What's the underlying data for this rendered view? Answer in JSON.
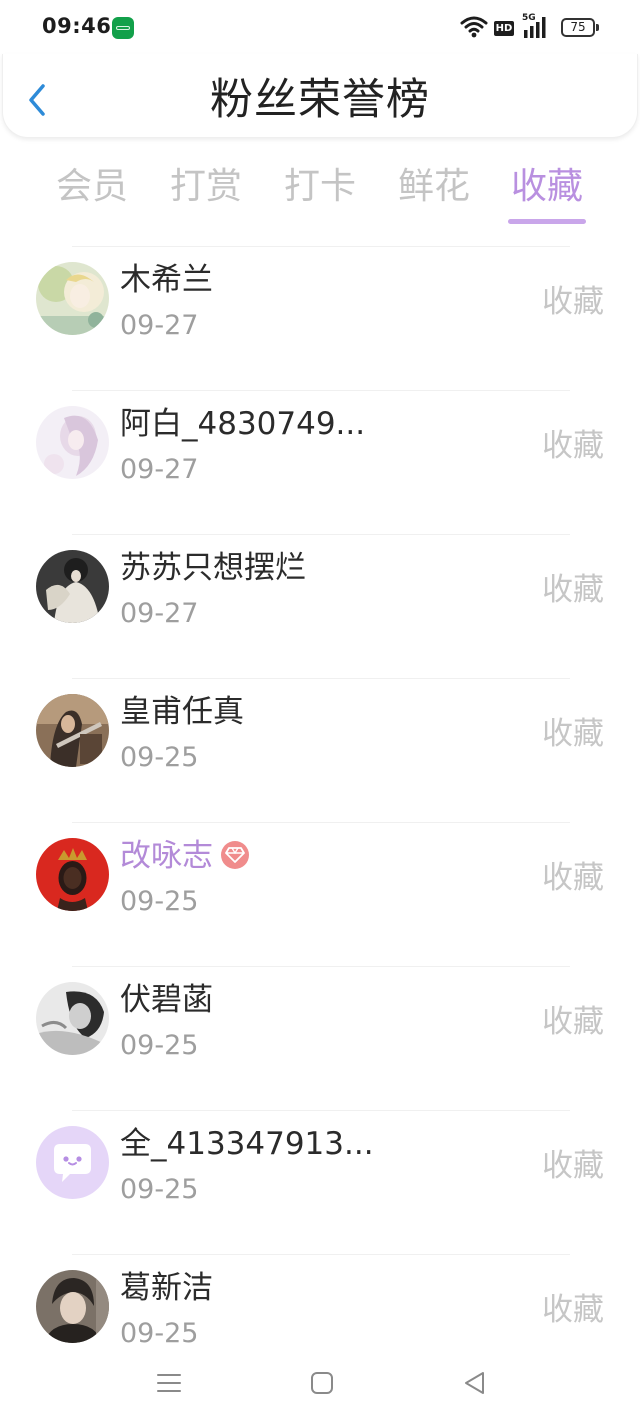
{
  "status_bar": {
    "time": "09:46",
    "network": "5G",
    "hd": "HD",
    "battery": "75"
  },
  "header": {
    "title": "粉丝荣誉榜",
    "back_icon": "chevron-left-icon",
    "back_color": "#2e8bd8"
  },
  "tabs": [
    {
      "label": "会员",
      "active": false
    },
    {
      "label": "打赏",
      "active": false
    },
    {
      "label": "打卡",
      "active": false
    },
    {
      "label": "鲜花",
      "active": false
    },
    {
      "label": "收藏",
      "active": true
    }
  ],
  "colors": {
    "accent": "#b990e0",
    "vip_name": "#b38ad8",
    "vip_badge": "#f08c8c",
    "inactive_tab": "#c4c4c4",
    "muted": "#9e9e9e"
  },
  "fans": [
    {
      "name": "木希兰",
      "date": "09-27",
      "action": "收藏",
      "vip": false
    },
    {
      "name": "阿白_4830749...",
      "date": "09-27",
      "action": "收藏",
      "vip": false
    },
    {
      "name": "苏苏只想摆烂",
      "date": "09-27",
      "action": "收藏",
      "vip": false
    },
    {
      "name": "皇甫任真",
      "date": "09-25",
      "action": "收藏",
      "vip": false
    },
    {
      "name": "改咏志",
      "date": "09-25",
      "action": "收藏",
      "vip": true
    },
    {
      "name": "伏碧菡",
      "date": "09-25",
      "action": "收藏",
      "vip": false
    },
    {
      "name": "全_413347913...",
      "date": "09-25",
      "action": "收藏",
      "vip": false
    },
    {
      "name": "葛新洁",
      "date": "09-25",
      "action": "收藏",
      "vip": false
    }
  ],
  "nav_bar": {
    "icons": [
      "menu-icon",
      "home-icon",
      "back-triangle-icon"
    ]
  }
}
